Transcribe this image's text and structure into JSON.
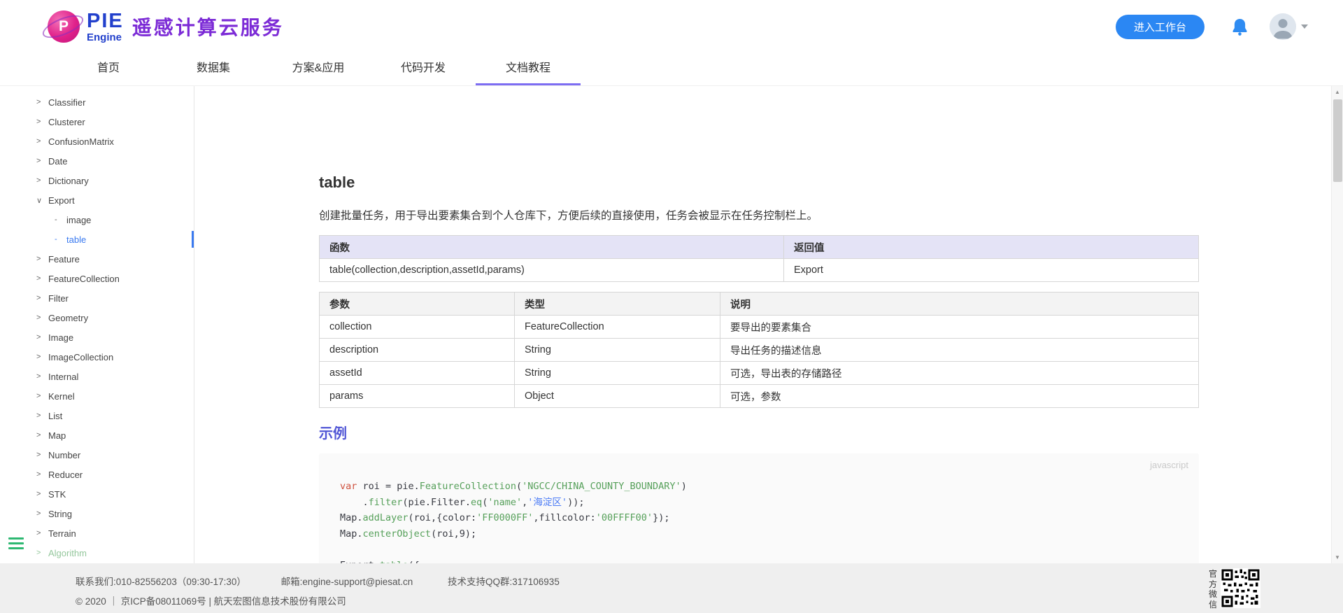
{
  "header": {
    "logo_p": "P",
    "logo_pie": "PIE",
    "logo_engine": "Engine",
    "title": "遥感计算云服务",
    "workspace_button": "进入工作台"
  },
  "nav": {
    "tabs": [
      {
        "label": "首页",
        "active": false
      },
      {
        "label": "数据集",
        "active": false
      },
      {
        "label": "方案&应用",
        "active": false
      },
      {
        "label": "代码开发",
        "active": false
      },
      {
        "label": "文档教程",
        "active": true
      }
    ]
  },
  "sidebar": {
    "items": [
      {
        "label": "Classifier",
        "type": "collapsed"
      },
      {
        "label": "Clusterer",
        "type": "collapsed"
      },
      {
        "label": "ConfusionMatrix",
        "type": "collapsed"
      },
      {
        "label": "Date",
        "type": "collapsed"
      },
      {
        "label": "Dictionary",
        "type": "collapsed"
      },
      {
        "label": "Export",
        "type": "expanded"
      },
      {
        "label": "image",
        "type": "child"
      },
      {
        "label": "table",
        "type": "child",
        "selected": true
      },
      {
        "label": "Feature",
        "type": "collapsed"
      },
      {
        "label": "FeatureCollection",
        "type": "collapsed"
      },
      {
        "label": "Filter",
        "type": "collapsed"
      },
      {
        "label": "Geometry",
        "type": "collapsed"
      },
      {
        "label": "Image",
        "type": "collapsed"
      },
      {
        "label": "ImageCollection",
        "type": "collapsed"
      },
      {
        "label": "Internal",
        "type": "collapsed"
      },
      {
        "label": "Kernel",
        "type": "collapsed"
      },
      {
        "label": "List",
        "type": "collapsed"
      },
      {
        "label": "Map",
        "type": "collapsed"
      },
      {
        "label": "Number",
        "type": "collapsed"
      },
      {
        "label": "Reducer",
        "type": "collapsed"
      },
      {
        "label": "STK",
        "type": "collapsed"
      },
      {
        "label": "String",
        "type": "collapsed"
      },
      {
        "label": "Terrain",
        "type": "collapsed"
      },
      {
        "label": "Algorithm",
        "type": "collapsed",
        "muted": true
      }
    ]
  },
  "main": {
    "title": "table",
    "description": "创建批量任务，用于导出要素集合到个人仓库下，方便后续的直接使用，任务会被显示在任务控制栏上。",
    "signature_table": {
      "headers": [
        "函数",
        "返回值"
      ],
      "rows": [
        [
          "table(collection,description,assetId,params)",
          "Export"
        ]
      ]
    },
    "params_table": {
      "headers": [
        "参数",
        "类型",
        "说明"
      ],
      "rows": [
        [
          "collection",
          "FeatureCollection",
          "要导出的要素集合"
        ],
        [
          "description",
          "String",
          "导出任务的描述信息"
        ],
        [
          "assetId",
          "String",
          "可选，导出表的存储路径"
        ],
        [
          "params",
          "Object",
          "可选，参数"
        ]
      ]
    },
    "example_heading": "示例",
    "code": {
      "language": "javascript",
      "lines": [
        {
          "tokens": [
            {
              "t": "var ",
              "c": "kw"
            },
            {
              "t": "roi = pie.",
              "c": "pl"
            },
            {
              "t": "FeatureCollection",
              "c": "fn"
            },
            {
              "t": "(",
              "c": "pl"
            },
            {
              "t": "'NGCC/CHINA_COUNTY_BOUNDARY'",
              "c": "str"
            },
            {
              "t": ")",
              "c": "pl"
            }
          ]
        },
        {
          "tokens": [
            {
              "t": "    .",
              "c": "pl"
            },
            {
              "t": "filter",
              "c": "fn"
            },
            {
              "t": "(pie.Filter.",
              "c": "pl"
            },
            {
              "t": "eq",
              "c": "fn"
            },
            {
              "t": "(",
              "c": "pl"
            },
            {
              "t": "'name'",
              "c": "str"
            },
            {
              "t": ",",
              "c": "pl"
            },
            {
              "t": "'海淀区'",
              "c": "strb"
            },
            {
              "t": "));",
              "c": "pl"
            }
          ]
        },
        {
          "tokens": [
            {
              "t": "Map.",
              "c": "pl"
            },
            {
              "t": "addLayer",
              "c": "fn"
            },
            {
              "t": "(roi,{color:",
              "c": "pl"
            },
            {
              "t": "'FF0000FF'",
              "c": "str"
            },
            {
              "t": ",fillcolor:",
              "c": "pl"
            },
            {
              "t": "'00FFFF00'",
              "c": "str"
            },
            {
              "t": "});",
              "c": "pl"
            }
          ]
        },
        {
          "tokens": [
            {
              "t": "Map.",
              "c": "pl"
            },
            {
              "t": "centerObject",
              "c": "fn"
            },
            {
              "t": "(roi,9);",
              "c": "pl"
            }
          ]
        },
        {
          "tokens": []
        },
        {
          "tokens": [
            {
              "t": "Export.",
              "c": "pl"
            },
            {
              "t": "table",
              "c": "fn"
            },
            {
              "t": "({",
              "c": "pl"
            }
          ]
        }
      ]
    }
  },
  "footer": {
    "contact": "联系我们:010-82556203（09:30-17:30）",
    "email": "邮箱:engine-support@piesat.cn",
    "qq_group": "技术支持QQ群:317106935",
    "copyright": "© 2020 ｜ 京ICP备08011069号 | 航天宏图信息技术股份有限公司",
    "wechat_label": "官方微信"
  },
  "icons": {
    "notification": "bell-icon",
    "user": "avatar",
    "collapsed": "chevron-right-icon",
    "expanded": "chevron-down-icon",
    "menu": "hamburger-icon",
    "wechat_qr": "qr-code"
  },
  "colors": {
    "brand_blue": "#2240cc",
    "brand_purple": "#7c2bd6",
    "logo_pink": "#e0218a",
    "button_blue": "#2b87f3",
    "active_tab_underline": "#7d6df2",
    "selected_item_blue": "#3a7af0",
    "sig_header_bg": "#e4e3f6",
    "param_header_bg": "#f3f3f3",
    "example_heading": "#5257d6",
    "code_bg": "#fafafa",
    "footer_bg": "#efefef",
    "hamburger_green": "#2eb872",
    "code_keyword": "#cf5340",
    "code_function": "#56a05a",
    "code_string": "#56a05a",
    "code_string_alt": "#4b7bf5"
  }
}
